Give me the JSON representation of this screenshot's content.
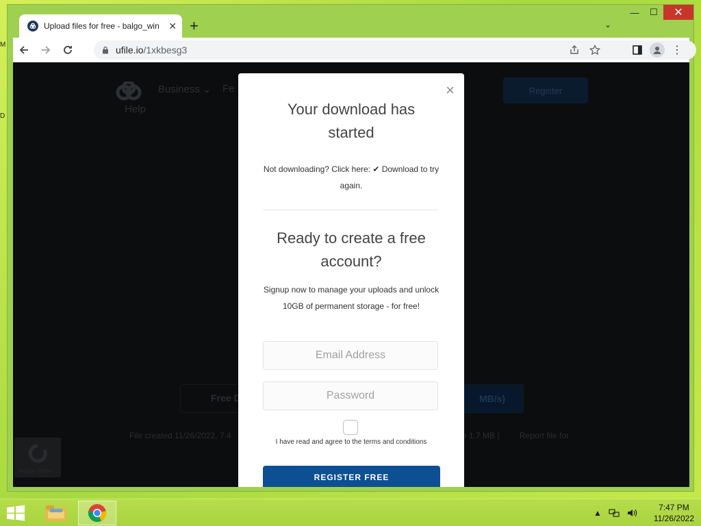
{
  "desktop": {
    "left_fragments": [
      "M",
      "D"
    ]
  },
  "window": {
    "minimize": "—",
    "maximize": "☐",
    "close": "✕"
  },
  "browser": {
    "tab": {
      "title": "Upload files for free - balgo_win",
      "close": "✕"
    },
    "new_tab": "+",
    "tab_dropdown": "⌄",
    "url_host": "ufile.io",
    "url_path": "/1xkbesg3"
  },
  "background_page": {
    "nav_business": "Business ⌄",
    "nav_fe": "Fe",
    "nav_help": "Help",
    "register": "Register",
    "free_btn_left": "Free D",
    "free_btn_right": "MB/s)",
    "meta_created": "File created  11/26/2022, 7:4",
    "meta_size": "e  1.7 MB   |",
    "meta_report": "Report file for",
    "recaptcha_text": "Privacy - Terms"
  },
  "modal": {
    "close": "×",
    "heading_download": "Your download has started",
    "not_downloading_text": "Not downloading? Click here: ✔ Download to try again.",
    "heading_account": "Ready to create a free account?",
    "signup_text": "Signup now to manage your uploads and unlock 10GB of permanent storage - for free!",
    "email_placeholder": "Email Address",
    "password_placeholder": "Password",
    "terms_text": "I have read and agree to the terms and conditions",
    "register_button": "REGISTER FREE"
  },
  "taskbar": {
    "time": "7:47 PM",
    "date": "11/26/2022"
  },
  "colors": {
    "desktop": "#b6e24a",
    "modal_button": "#0d4f93",
    "page_overlay": "#0c0d0e"
  }
}
